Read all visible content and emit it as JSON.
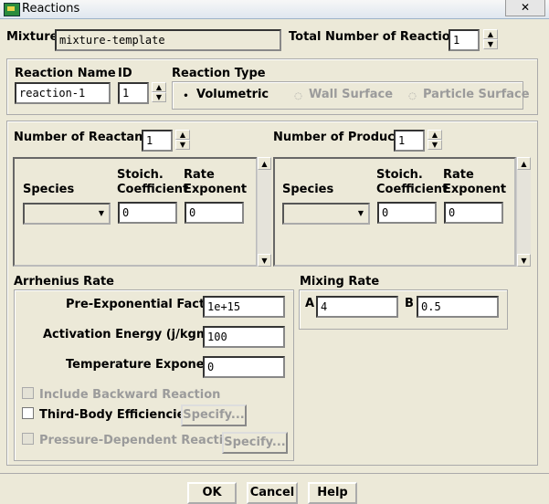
{
  "window": {
    "title": "Reactions",
    "close_symbol": "✕"
  },
  "mixture": {
    "label": "Mixture",
    "value": "mixture-template"
  },
  "total_reactions": {
    "label": "Total Number of Reactions",
    "value": "1"
  },
  "reaction": {
    "name_label": "Reaction Name",
    "name_value": "reaction-1",
    "id_label": "ID",
    "id_value": "1"
  },
  "reaction_type": {
    "label": "Reaction Type",
    "options": [
      "Volumetric",
      "Wall Surface",
      "Particle Surface"
    ],
    "selected": "Volumetric"
  },
  "reactants": {
    "label": "Number of Reactants",
    "count": "1",
    "species_header": "Species",
    "stoich_header_1": "Stoich.",
    "stoich_header_2": "Coefficient",
    "rate_header_1": "Rate",
    "rate_header_2": "Exponent",
    "stoich_value": "0",
    "rate_value": "0"
  },
  "products": {
    "label": "Number of Products",
    "count": "1",
    "species_header": "Species",
    "stoich_header_1": "Stoich.",
    "stoich_header_2": "Coefficient",
    "rate_header_1": "Rate",
    "rate_header_2": "Exponent",
    "stoich_value": "0",
    "rate_value": "0"
  },
  "arrhenius": {
    "label": "Arrhenius Rate",
    "pre_exp_label": "Pre-Exponential Factor",
    "pre_exp_value": "1e+15",
    "activation_label": "Activation Energy (j/kgmol)",
    "activation_value": "100",
    "temp_exp_label": "Temperature Exponent",
    "temp_exp_value": "0"
  },
  "options": {
    "include_backward": "Include Backward Reaction",
    "third_body": "Third-Body Efficiencies",
    "pressure_dependent": "Pressure-Dependent Reaction",
    "specify": "Specify..."
  },
  "mixing_rate": {
    "label": "Mixing Rate",
    "a_label": "A",
    "a_value": "4",
    "b_label": "B",
    "b_value": "0.5"
  },
  "buttons": {
    "ok": "OK",
    "cancel": "Cancel",
    "help": "Help"
  }
}
